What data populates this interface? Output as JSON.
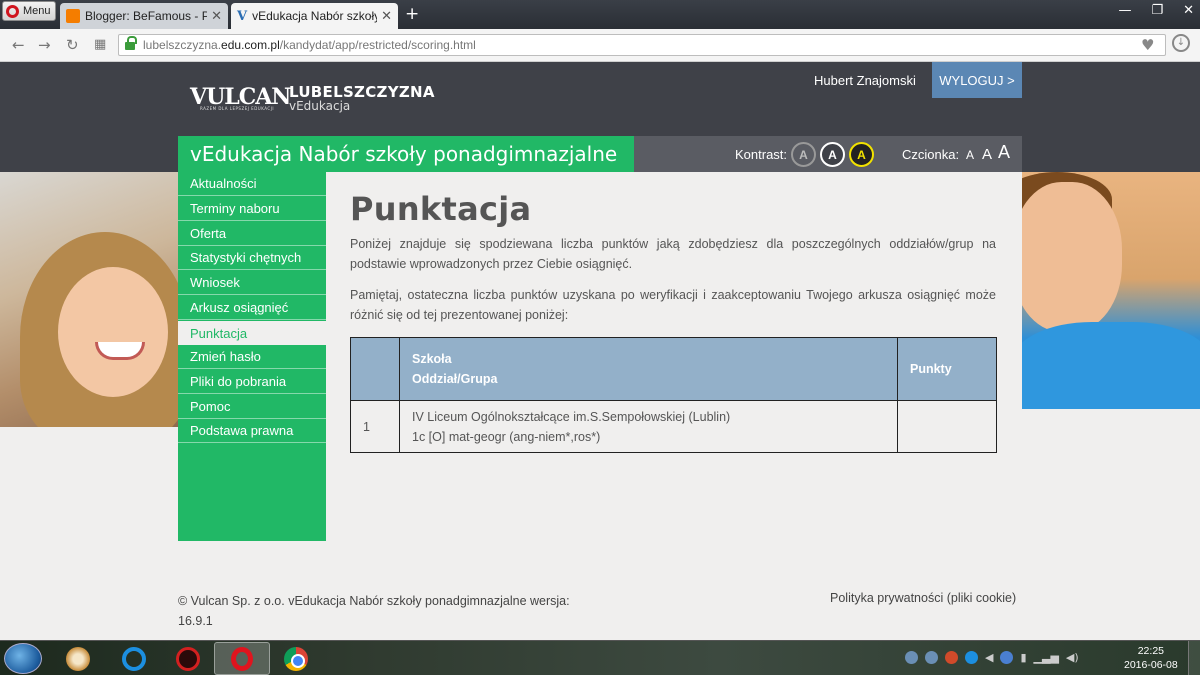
{
  "browser": {
    "menu_label": "Menu",
    "tabs": [
      {
        "title": "Blogger: BeFamous - Przeg",
        "close": "✕"
      },
      {
        "title": "vEdukacja Nabór szkoły po",
        "close": "✕"
      }
    ],
    "new_tab": "+",
    "url_prefix": "lubelszczyzna.",
    "url_domain": "edu.com.pl",
    "url_path": "/kandydat/app/restricted/scoring.html"
  },
  "header": {
    "logo_text": "VULCAN",
    "logo_tagline": "RAZEM DLA LEPSZEJ EDUKACJI",
    "region": "LUBELSZCZYZNA",
    "region_sub": "vEdukacja",
    "user_name": "Hubert Znajomski",
    "logout": "WYLOGUJ >"
  },
  "title_strip": {
    "app_title": "vEdukacja Nabór szkoły ponadgimnazjalne",
    "contrast_label": "Kontrast:",
    "contrast_options": [
      "A",
      "A",
      "A"
    ],
    "font_label": "Czcionka:",
    "font_sizes": [
      "A",
      "A",
      "A"
    ]
  },
  "sidebar": {
    "items": [
      {
        "label": "Aktualności"
      },
      {
        "label": "Terminy naboru"
      },
      {
        "label": "Oferta"
      },
      {
        "label": "Statystyki chętnych"
      },
      {
        "label": "Wniosek"
      },
      {
        "label": "Arkusz osiągnięć"
      },
      {
        "label": "Punktacja"
      },
      {
        "label": "Zmień hasło"
      },
      {
        "label": "Pliki do pobrania"
      },
      {
        "label": "Pomoc"
      },
      {
        "label": "Podstawa prawna"
      }
    ],
    "active_index": 6
  },
  "main": {
    "title": "Punktacja",
    "para1": "Poniżej znajduje się spodziewana liczba punktów jaką zdobędziesz dla poszczególnych oddziałów/grup na podstawie wprowadzonych przez Ciebie osiągnięć.",
    "para2": "Pamiętaj, ostateczna liczba punktów uzyskana po weryfikacji i zaakceptowaniu Twojego arkusza osiągnięć może różnić się od tej prezentowanej poniżej:",
    "table": {
      "header_school": "Szkoła",
      "header_group": "Oddział/Grupa",
      "header_points": "Punkty",
      "rows": [
        {
          "num": "1",
          "school": "IV Liceum Ogólnokształcące im.S.Sempołowskiej (Lublin)",
          "group": "1c [O] mat-geogr (ang-niem*,ros*)",
          "points": ""
        }
      ]
    }
  },
  "footer": {
    "copyright_line1": "© Vulcan Sp. z o.o. vEdukacja Nabór szkoły ponadgimnazjalne wersja:",
    "copyright_line2": "16.9.1",
    "privacy": "Polityka prywatności (pliki cookie)"
  },
  "taskbar": {
    "time": "22:25",
    "date": "2016-06-08"
  }
}
